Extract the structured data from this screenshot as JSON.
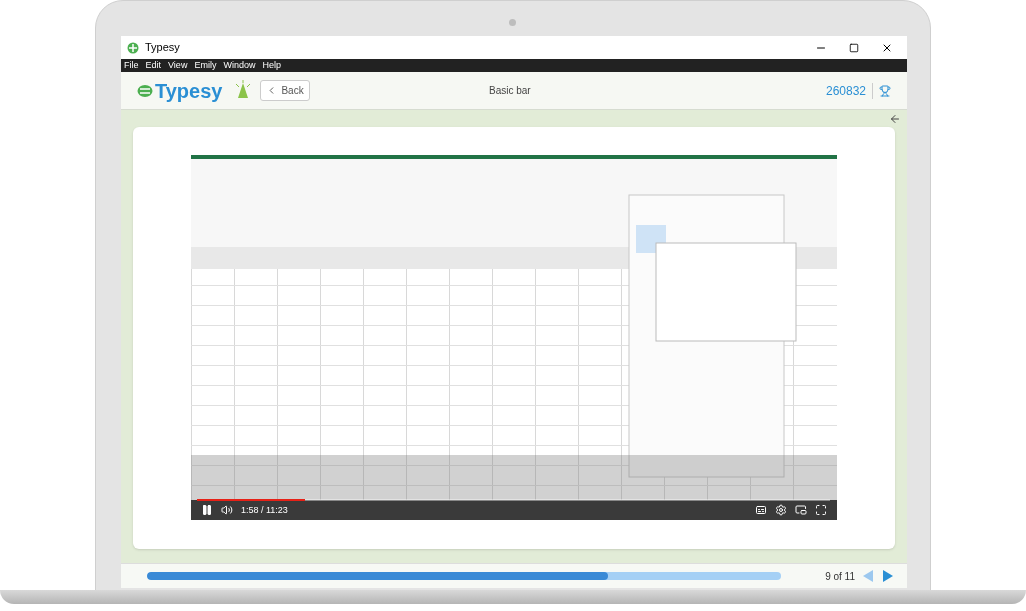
{
  "window": {
    "title": "Typesy"
  },
  "menu": [
    "File",
    "Edit",
    "View",
    "Emily",
    "Window",
    "Help"
  ],
  "header": {
    "logo": "Typesy",
    "back": "Back",
    "lesson_title": "Basic bar",
    "score": "260832"
  },
  "video": {
    "playing": true,
    "level": 0.17,
    "time": "1:58 / 11:23"
  },
  "footer": {
    "progress": {
      "level": 0.727
    },
    "page": "9 of 11",
    "prev_disabled": true,
    "next_disabled": false
  }
}
